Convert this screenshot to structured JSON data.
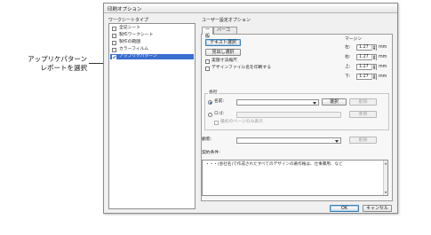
{
  "callout": {
    "line1": "アップリケパターン",
    "line2": "レポートを選択"
  },
  "dialog": {
    "title": "印刷オプション",
    "worksheet_types_label": "ワークシートタイプ",
    "user_options_label": "ユーザー設定オプション",
    "ok_label": "OK",
    "cancel_label": "キャンセル"
  },
  "worksheets": [
    {
      "label": "全記シート",
      "checked": false,
      "selected": false
    },
    {
      "label": "製作ワークシート",
      "checked": false,
      "selected": false
    },
    {
      "label": "製作の範囲",
      "checked": false,
      "selected": false
    },
    {
      "label": "カラーフィルム",
      "checked": false,
      "selected": false
    },
    {
      "label": "アップリケパターン",
      "checked": true,
      "selected": true
    }
  ],
  "tabs": [
    {
      "label": "一般",
      "active": true
    },
    {
      "label": "バーコード",
      "active": false
    }
  ],
  "general": {
    "text_select_label": "テキスト選択",
    "header_select_label": "見出し選択",
    "real_scale_label": "実施寸法縮尺",
    "print_filename_label": "デザインファイル名を印刷する",
    "margins_label": "マージン",
    "margins": [
      {
        "label": "左:",
        "value": "1.27",
        "unit": "mm"
      },
      {
        "label": "右:",
        "value": "1.27",
        "unit": "mm"
      },
      {
        "label": "上:",
        "value": "1.27",
        "unit": "mm"
      },
      {
        "label": "下:",
        "value": "1.27",
        "unit": "mm"
      }
    ],
    "company_label": "会社",
    "name_label": "名前:",
    "select_btn": "選択",
    "delete_btn": "削除",
    "logo_label": "ロゴ:",
    "browse_btn": "参照",
    "first_page_only_label": "最初のページのみ表示",
    "customer_label": "顧客:",
    "customer_delete_btn": "削除",
    "terms_label": "契約条件:",
    "terms_text": "・・・(会社名)で作成されたすべてのデザインの著作権は、仕事費用、など"
  }
}
